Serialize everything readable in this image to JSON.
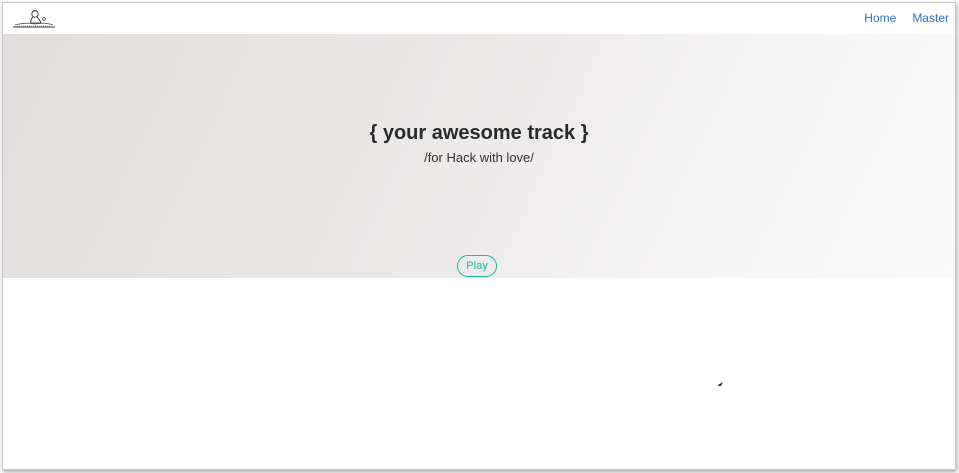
{
  "navbar": {
    "links": [
      {
        "label": "Home"
      },
      {
        "label": "Master"
      }
    ]
  },
  "hero": {
    "title": "{ your awesome track }",
    "subtitle": "/for Hack with love/",
    "play_label": "Play"
  },
  "colors": {
    "link": "#2f6fcf",
    "accent": "#1abc9c",
    "title_text": "#2a2a2a"
  },
  "icons": {
    "logo": "dj-turntable-logo",
    "cursor": "mouse-pointer-icon"
  }
}
